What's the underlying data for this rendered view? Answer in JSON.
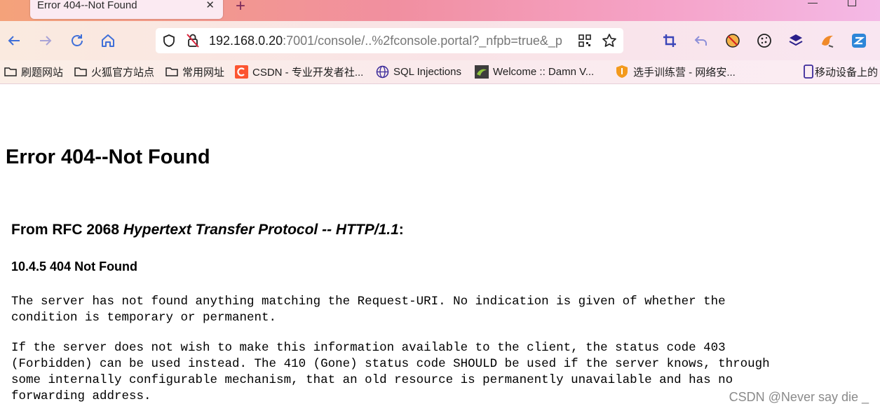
{
  "tab": {
    "title": "Error 404--Not Found",
    "close_glyph": "✕",
    "new_tab_glyph": "+"
  },
  "address_bar": {
    "host": "192.168.0.20",
    "rest": ":7001/console/..%2fconsole.portal?_nfpb=true&_p"
  },
  "bookmarks": [
    {
      "label": "刷题网站",
      "icon": "folder-icon"
    },
    {
      "label": "火狐官方站点",
      "icon": "folder-icon"
    },
    {
      "label": "常用网址",
      "icon": "folder-icon"
    },
    {
      "label": "CSDN - 专业开发者社...",
      "icon": "csdn-icon"
    },
    {
      "label": "SQL Injections",
      "icon": "globe-icon"
    },
    {
      "label": "Welcome :: Damn V...",
      "icon": "dvwa-icon"
    },
    {
      "label": "选手训练营 - 网络安...",
      "icon": "shield-icon"
    },
    {
      "label": "移动设备上的",
      "icon": "mobile-icon"
    }
  ],
  "page": {
    "heading": "Error 404--Not Found",
    "rfc_prefix": "From RFC 2068 ",
    "rfc_title": "Hypertext Transfer Protocol -- HTTP/1.1",
    "rfc_suffix": ":",
    "section": "10.4.5 404 Not Found",
    "para1": "The server has not found anything matching the Request-URI. No indication is given of whether the\ncondition is temporary or permanent.",
    "para2": "If the server does not wish to make this information available to the client, the status code 403\n(Forbidden) can be used instead. The 410 (Gone) status code SHOULD be used if the server knows, through\nsome internally configurable mechanism, that an old resource is permanently unavailable and has no\nforwarding address."
  },
  "watermark": "CSDN @Never say die _",
  "colors": {
    "accent": "#3f6fd8",
    "csdn": "#fc5531"
  }
}
